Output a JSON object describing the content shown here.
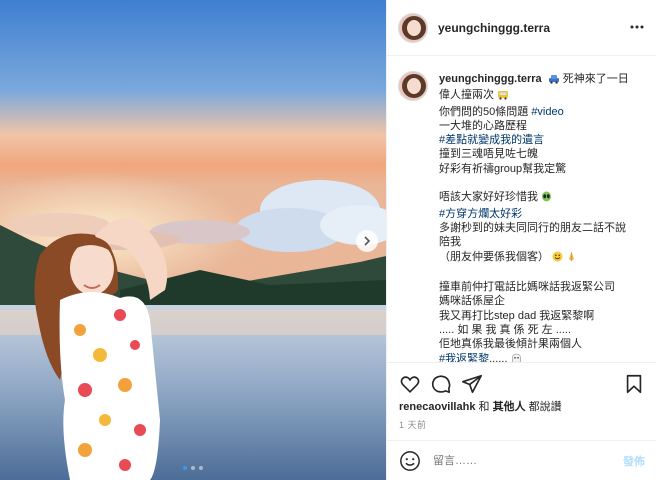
{
  "header": {
    "username": "yeungchinggg.terra",
    "more_icon": "more-horizontal-icon"
  },
  "caption": {
    "username": "yeungchinggg.terra",
    "lines": [
      "死神來了一日",
      "偉人撞兩次",
      "你們問的50條問題",
      "#video",
      "一大堆的心路歷程",
      "#差點就變成我的遺言",
      "撞到三魂唔見咗七魄",
      "好彩有祈禱group幫我定驚",
      "唔該大家好好珍惜我",
      "#方穿方爛太好彩",
      "多謝秒到的妹夫同同行的朋友二話不說",
      "陪我",
      "（朋友仲要係我個客）",
      "撞車前仲打電話比媽咪話我返緊公司",
      "媽咪話係屋企",
      "我又再打比step dad 我返緊黎啊",
      "..... 如 果 我 真 係 死 左 .....",
      "佢地真係我最後傾計果兩個人",
      "#我返緊黎"
    ],
    "trailing_dots": "......"
  },
  "likes": {
    "user": "renecaovillahk",
    "and": "和",
    "others": "其他人",
    "suffix": "都說讚"
  },
  "time": "1 天前",
  "comment": {
    "placeholder": "留言……",
    "post_label": "發佈"
  },
  "colors": {
    "link": "#00376b",
    "post_button": "#b2dffc",
    "active_dot": "#3897f0"
  },
  "icons": [
    "heart-icon",
    "comment-icon",
    "share-icon",
    "bookmark-icon",
    "smile-icon",
    "chevron-right-icon"
  ]
}
